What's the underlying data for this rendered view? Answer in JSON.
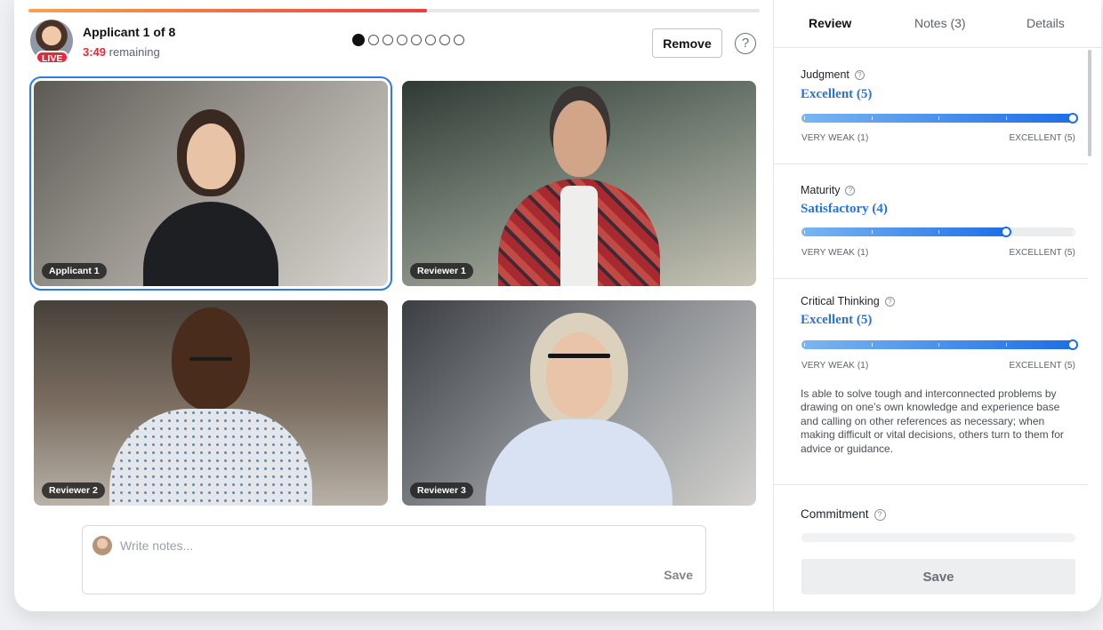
{
  "header": {
    "title": "Applicant 1 of 8",
    "time_value": "3:49",
    "time_suffix": " remaining",
    "live_badge": "LIVE",
    "remove_label": "Remove",
    "help_glyph": "?",
    "progress_fraction": 0.545,
    "progress_colors": [
      "#f6a34a",
      "#ef3d3d"
    ],
    "pager": {
      "total": 8,
      "current": 1
    }
  },
  "tiles": [
    {
      "label": "Applicant 1",
      "selected": true
    },
    {
      "label": "Reviewer 1",
      "selected": false
    },
    {
      "label": "Reviewer 2",
      "selected": false
    },
    {
      "label": "Reviewer 3",
      "selected": false
    }
  ],
  "notes": {
    "placeholder": "Write notes...",
    "save_label": "Save"
  },
  "sidebar": {
    "tabs": [
      {
        "label": "Review",
        "active": true
      },
      {
        "label": "Notes (3)",
        "active": false
      },
      {
        "label": "Details",
        "active": false
      }
    ],
    "criteria": [
      {
        "name": "Judgment",
        "score_label": "Excellent (5)",
        "value": 5,
        "max": 5,
        "min_label": "VERY WEAK (1)",
        "max_label": "EXCELLENT (5)"
      },
      {
        "name": "Maturity",
        "score_label": "Satisfactory (4)",
        "value": 4,
        "max": 5,
        "min_label": "VERY WEAK (1)",
        "max_label": "EXCELLENT (5)"
      },
      {
        "name": "Critical Thinking",
        "score_label": "Excellent (5)",
        "value": 5,
        "max": 5,
        "min_label": "VERY WEAK (1)",
        "max_label": "EXCELLENT (5)",
        "description": "Is able to solve tough and interconnected problems by drawing on one’s own knowledge and experience base and calling on other references as necessary; when making difficult or vital decisions, others turn to them for advice or guidance."
      }
    ],
    "commitment_name": "Commitment",
    "save_label": "Save",
    "accent_color": "#2a72e0"
  }
}
